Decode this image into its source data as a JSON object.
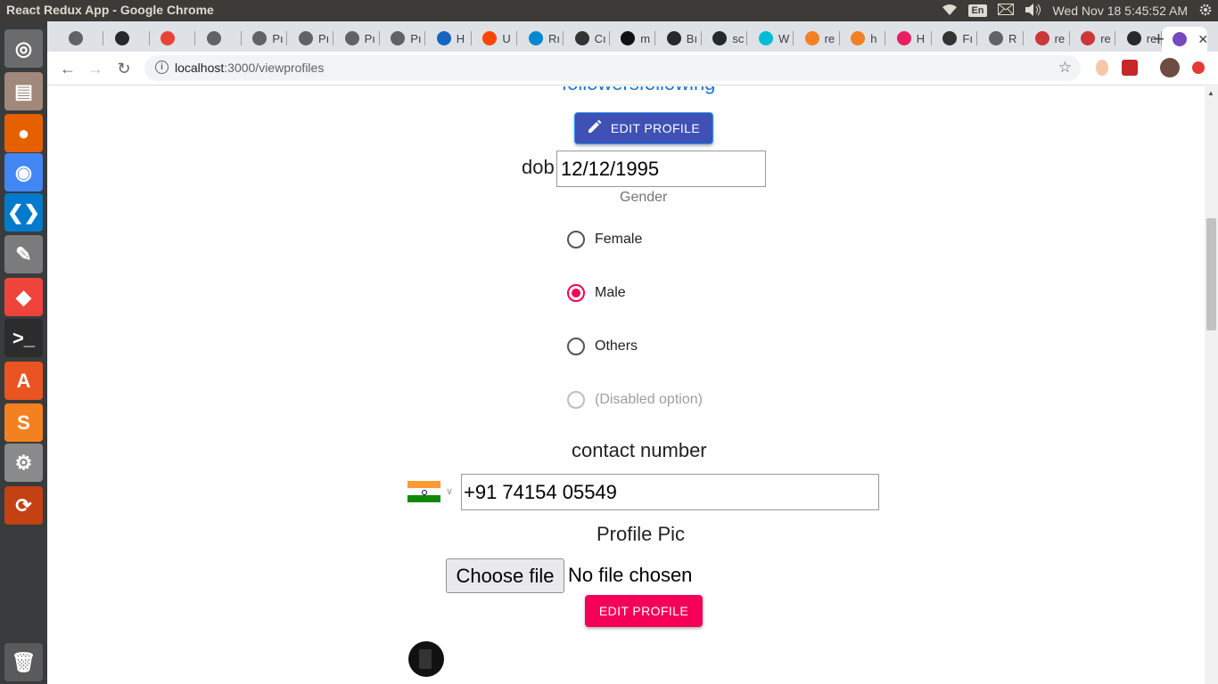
{
  "system": {
    "window_title": "React Redux App - Google Chrome",
    "keyboard_layout": "En",
    "clock": "Wed Nov 18  5:45:52 AM"
  },
  "launcher": {
    "apps": [
      {
        "name": "dash-home-icon",
        "glyph": "◎",
        "color": "#6b6b6b"
      },
      {
        "name": "files-icon",
        "glyph": "▤",
        "color": "#a0887a"
      },
      {
        "name": "firefox-icon",
        "glyph": "●",
        "color": "#e66000"
      },
      {
        "name": "chrome-icon",
        "glyph": "◉",
        "color": "#4285f4"
      },
      {
        "name": "vscode-icon",
        "glyph": "❮❯",
        "color": "#007acc"
      },
      {
        "name": "text-editor-icon",
        "glyph": "✎",
        "color": "#7b7b7b"
      },
      {
        "name": "anydesk-icon",
        "glyph": "◆",
        "color": "#ef443b"
      },
      {
        "name": "terminal-icon",
        "glyph": ">_",
        "color": "#2c2c2c"
      },
      {
        "name": "software-center-icon",
        "glyph": "A",
        "color": "#e95420"
      },
      {
        "name": "sublime-icon",
        "glyph": "S",
        "color": "#f48120"
      },
      {
        "name": "settings-icon",
        "glyph": "⚙",
        "color": "#8a8a8a"
      },
      {
        "name": "software-updater-icon",
        "glyph": "⟳",
        "color": "#c34113"
      },
      {
        "name": "trash-icon",
        "glyph": "🗑",
        "color": "#5a5a5a"
      }
    ]
  },
  "tabs": [
    {
      "label": "",
      "fav": "#5f6368"
    },
    {
      "label": "",
      "fav": "#24292e"
    },
    {
      "label": "",
      "fav": "#ea4335"
    },
    {
      "label": "",
      "fav": "#5f6368"
    },
    {
      "label": "Pı",
      "fav": "#5f6368"
    },
    {
      "label": "Pı",
      "fav": "#5f6368"
    },
    {
      "label": "Pı",
      "fav": "#5f6368"
    },
    {
      "label": "Pı",
      "fav": "#5f6368"
    },
    {
      "label": "H",
      "fav": "#1565c0"
    },
    {
      "label": "U",
      "fav": "#ff4500"
    },
    {
      "label": "Rı",
      "fav": "#0288d1"
    },
    {
      "label": "Cı",
      "fav": "#333333"
    },
    {
      "label": "m",
      "fav": "#111111"
    },
    {
      "label": "Bı",
      "fav": "#24292e"
    },
    {
      "label": "sc",
      "fav": "#24292e"
    },
    {
      "label": "W",
      "fav": "#00bcd4"
    },
    {
      "label": "re",
      "fav": "#f48024"
    },
    {
      "label": "h",
      "fav": "#f48024"
    },
    {
      "label": "H",
      "fav": "#e91e63"
    },
    {
      "label": "Fı",
      "fav": "#333333"
    },
    {
      "label": "R",
      "fav": "#5f6368"
    },
    {
      "label": "re",
      "fav": "#cb3837"
    },
    {
      "label": "re",
      "fav": "#cb3837"
    },
    {
      "label": "re",
      "fav": "#24292e"
    },
    {
      "label": "",
      "fav": "#764abc",
      "active": true
    }
  ],
  "browser": {
    "url_host": "localhost",
    "url_path": ":3000/viewprofiles"
  },
  "profile": {
    "followers_link": "followersfollowing",
    "edit_profile_top": "EDIT PROFILE",
    "dob_label": "dob",
    "dob_value": "12/12/1995",
    "gender_label": "Gender",
    "gender_options": [
      {
        "label": "Female",
        "checked": false,
        "disabled": false
      },
      {
        "label": "Male",
        "checked": true,
        "disabled": false
      },
      {
        "label": "Others",
        "checked": false,
        "disabled": false
      },
      {
        "label": "(Disabled option)",
        "checked": false,
        "disabled": true
      }
    ],
    "contact_label": "contact number",
    "phone_value": "+91 74154 05549",
    "profile_pic_label": "Profile Pic",
    "choose_file_label": "Choose file",
    "no_file_text": "No file chosen",
    "edit_profile_bottom": "EDIT PROFILE"
  },
  "colors": {
    "primary": "#3f51b5",
    "secondary": "#f50057",
    "link": "#1976d2"
  }
}
